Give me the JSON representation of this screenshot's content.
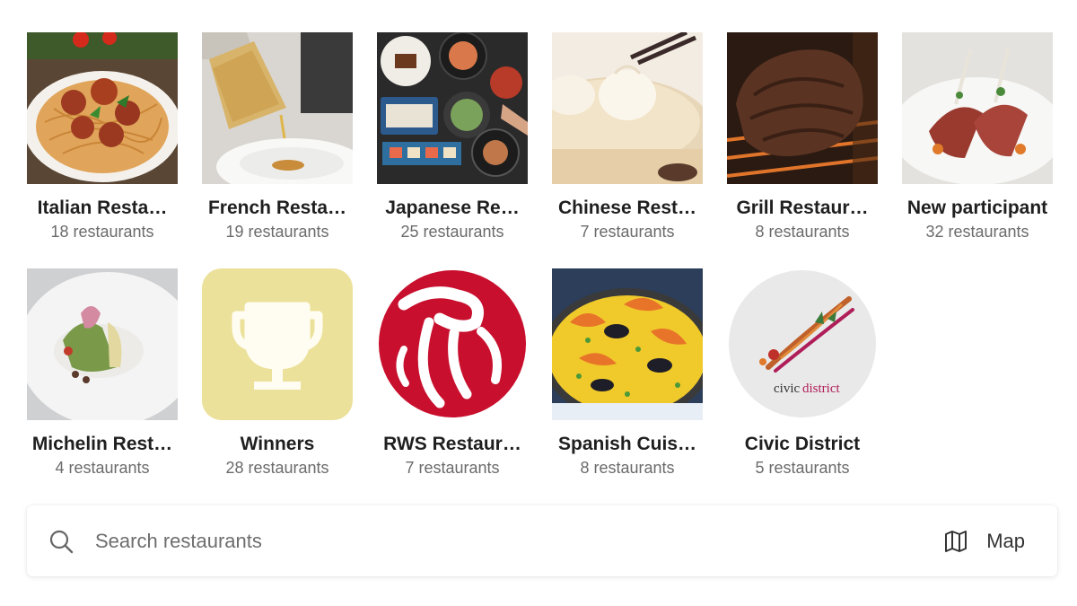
{
  "categories": [
    {
      "name": "Italian Restaurants",
      "display": "Italian Resta…",
      "count": "18 restaurants",
      "icon": "pasta-image"
    },
    {
      "name": "French Restaurants",
      "display": "French Resta…",
      "count": "19 restaurants",
      "icon": "sauce-pour-image"
    },
    {
      "name": "Japanese Restaurants",
      "display": "Japanese Re…",
      "count": "25 restaurants",
      "icon": "japanese-dishes-image"
    },
    {
      "name": "Chinese Restaurants",
      "display": "Chinese Rest…",
      "count": "7 restaurants",
      "icon": "dumpling-image"
    },
    {
      "name": "Grill Restaurants",
      "display": "Grill Restaur…",
      "count": "8 restaurants",
      "icon": "grilled-meat-image"
    },
    {
      "name": "New participant",
      "display": "New participant",
      "count": "32 restaurants",
      "icon": "lamb-rack-image"
    },
    {
      "name": "Michelin Restaurants",
      "display": "Michelin Rest…",
      "count": "4 restaurants",
      "icon": "fine-dining-image"
    },
    {
      "name": "Winners",
      "display": "Winners",
      "count": "28 restaurants",
      "icon": "trophy-icon"
    },
    {
      "name": "RWS Restaurants",
      "display": "RWS Restaur…",
      "count": "7 restaurants",
      "icon": "rws-logo"
    },
    {
      "name": "Spanish Cuisine",
      "display": "Spanish Cuis…",
      "count": "8 restaurants",
      "icon": "paella-image"
    },
    {
      "name": "Civic District",
      "display": "Civic District",
      "count": "5 restaurants",
      "icon": "civic-district-logo"
    }
  ],
  "civic_logo": {
    "part1": "civic",
    "part2": "district"
  },
  "search": {
    "placeholder": "Search restaurants",
    "value": ""
  },
  "map_button": {
    "label": "Map"
  },
  "colors": {
    "trophy_bg": "#ece19a",
    "rws_red": "#c8102e",
    "civic_bg": "#e9e9e9",
    "civic_accent": "#b01e5a"
  }
}
